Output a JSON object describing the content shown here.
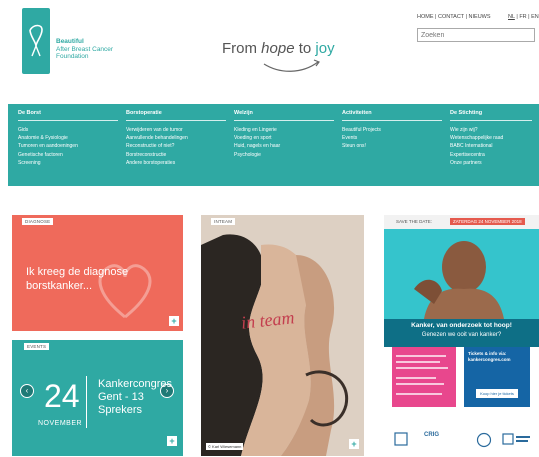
{
  "logo": {
    "line1": "Beautiful",
    "line2": "After Breast Cancer",
    "line3": "Foundation"
  },
  "tagline": {
    "part1": "From ",
    "part2": "hope",
    "part3": " to ",
    "part4": "joy"
  },
  "top_links": "HOME | CONTACT | NIEUWS",
  "languages": {
    "nl": "NL",
    "rest": " | FR | EN"
  },
  "search": {
    "placeholder": "Zoeken"
  },
  "menu": {
    "columns": [
      {
        "heading": "De Borst",
        "items": [
          "Gids",
          "Anatomie & Fysiologie",
          "Tumoren en aandoeningen",
          "Genetische factoren",
          "Screening"
        ]
      },
      {
        "heading": "Borstoperatie",
        "items": [
          "Verwijderen van de tumor",
          "Aanvullende behandelingen",
          "Reconstructie of niet?",
          "Borstreconstructie",
          "Andere borstoperaties"
        ]
      },
      {
        "heading": "Welzijn",
        "items": [
          "Kleding en Lingerie",
          "Voeding en sport",
          "Huid, nagels en haar",
          "Psychologie"
        ]
      },
      {
        "heading": "Activiteiten",
        "items": [
          "Beautiful Projects",
          "Events",
          "Steun ons!"
        ]
      },
      {
        "heading": "De Stichting",
        "items": [
          "Wie zijn wij?",
          "Wetenschappelijke raad",
          "BABC International",
          "Expertisecentra",
          "Onze partners"
        ]
      }
    ]
  },
  "cards": {
    "diagnose": {
      "badge": "DIAGNOSE",
      "title": "Ik kreeg de diagnose borstkanker..."
    },
    "events": {
      "badge": "EVENTS",
      "day": "24",
      "month": "NOVEMBER",
      "title_line1": "Kankercongres",
      "title_line2": "Gent - 13",
      "title_line3": "Sprekers"
    },
    "team": {
      "badge": "INTEAM",
      "overlay": "in team",
      "credit": "© Karl Wiesemann"
    },
    "save": {
      "label": "SAVE THE DATE:",
      "date": "ZATERDAG 24 NOVEMBER 2018",
      "headline": "Kanker, van onderzoek tot hoop!",
      "subline": "Genezen we ooit van kanker?",
      "tickets": "Tickets & info via:",
      "tickets_url": "kankercongres.com",
      "button": "Koop hier je tickets",
      "sponsor": "CRIG"
    }
  },
  "colors": {
    "teal": "#2fa9a3",
    "coral": "#ef6a5b",
    "pink": "#e8478d",
    "blue": "#1565a5"
  }
}
